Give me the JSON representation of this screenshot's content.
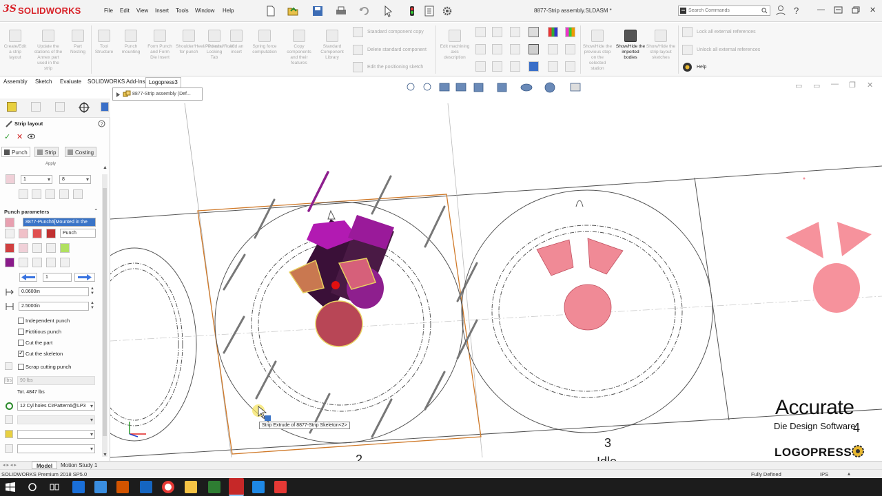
{
  "app": {
    "brand": "SOLIDWORKS",
    "brand_mark": "3S",
    "document_title": "8877-Strip assembly.SLDASM *"
  },
  "menu": [
    "File",
    "Edit",
    "View",
    "Insert",
    "Tools",
    "Window",
    "Help"
  ],
  "search": {
    "placeholder": "Search Commands"
  },
  "ribbon": {
    "buttons": [
      "Create/Edit a strip layout",
      "Update the stations of the Annex part used in the strip",
      "Part Nesting",
      "Tool Structure",
      "Punch mounting",
      "Form Punch and Form Die Insert",
      "Shoulder/Heel/Pedestal/Roof for punch",
      "Punch Locking Tab",
      "Add an insert",
      "Spring force computation",
      "Copy components and their features",
      "Standard Component Library"
    ],
    "stacked_commands": [
      "Standard component copy",
      "Delete standard component",
      "Edit the positioning sketch"
    ],
    "right_buttons": [
      "Edit machining axis description",
      "Show/Hide the previous step on the selected station",
      "Show/Hide the imported bodies",
      "Show/Hide the strip layout sketches"
    ],
    "references": [
      "Lock all external references",
      "Unlock all external references",
      "Help"
    ]
  },
  "command_tabs": [
    "Assembly",
    "Sketch",
    "Evaluate",
    "SOLIDWORKS Add-Ins",
    "Logopress3"
  ],
  "tree_popup": {
    "label": "8877-Strip assembly (Def..."
  },
  "property_manager": {
    "title": "Strip layout",
    "tabs": [
      "Punch",
      "Strip",
      "Costing"
    ],
    "apply_label": "Apply",
    "station_from": "1",
    "station_to": "8",
    "section_punch_parameters": "Punch parameters",
    "selected_feature": "8877-Punch6[Mounted in the",
    "punch_name": "Punch",
    "counter_value": "1",
    "clearance": "0.0600in",
    "length": "2.5000in",
    "options": [
      {
        "label": "Independent punch",
        "checked": false
      },
      {
        "label": "Fictitious punch",
        "checked": false
      },
      {
        "label": "Cut the part",
        "checked": false
      },
      {
        "label": "Cut the skeleton",
        "checked": true
      },
      {
        "label": "Scrap cutting punch",
        "checked": false
      }
    ],
    "force_units": "lbs",
    "force_value": "90 lbs",
    "total_force": "Tot. 4847 lbs",
    "pattern": "12 Cyl holes CirPattern6@LP3"
  },
  "viewport": {
    "tooltip": "Strip Extrude of 8877-Strip Skeleton<2>",
    "station_numbers": [
      "2",
      "3",
      "4"
    ],
    "idle_label": "Idle"
  },
  "watermark": {
    "line1": "Accurate",
    "line2": "Die Design Software",
    "line3": "LOGOPRESS"
  },
  "bottom_tabs": [
    "Model",
    "Motion Study 1"
  ],
  "status": {
    "product": "SOLIDWORKS Premium 2018 SP5.0",
    "state": "Fully Defined",
    "units": "IPS"
  },
  "colors": {
    "accent_red": "#d8232a",
    "punch_purple": "#8e1f8e",
    "part_pink": "#f08a96",
    "strip_outline": "#d07a2a",
    "selection_blue": "#3a74c7"
  }
}
